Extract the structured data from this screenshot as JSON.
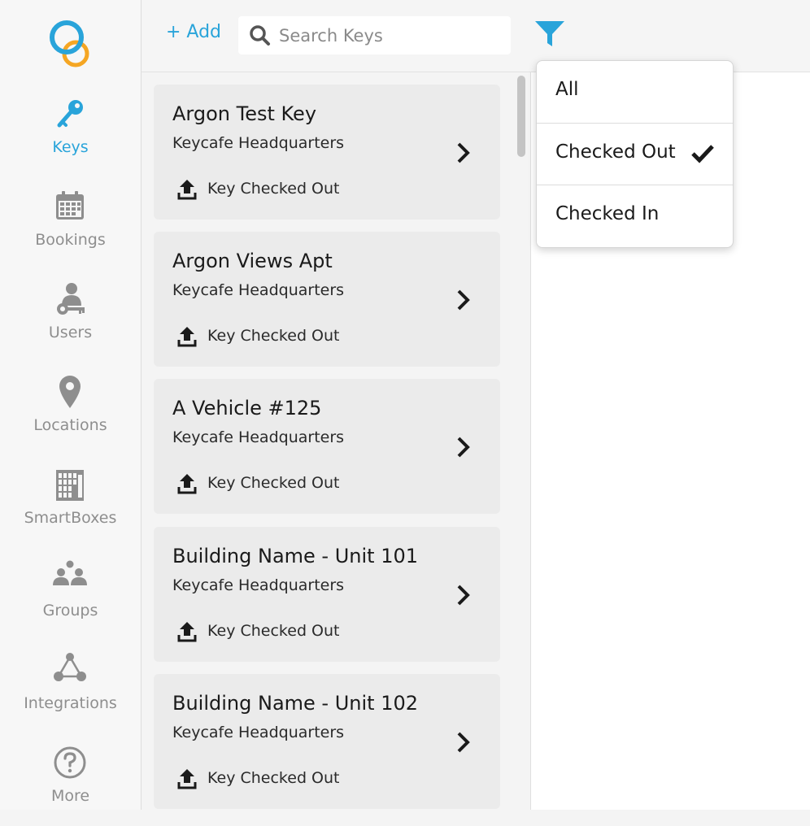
{
  "colors": {
    "accent": "#29a4da",
    "logo_orange": "#f5a623",
    "muted": "#8e8e8e",
    "card_bg": "#ebebeb"
  },
  "sidebar": {
    "logo": "keycafe-logo",
    "items": [
      {
        "label": "Keys",
        "icon": "key-icon",
        "active": true
      },
      {
        "label": "Bookings",
        "icon": "calendar-icon",
        "active": false
      },
      {
        "label": "Users",
        "icon": "user-key-icon",
        "active": false
      },
      {
        "label": "Locations",
        "icon": "location-pin-icon",
        "active": false
      },
      {
        "label": "SmartBoxes",
        "icon": "smartbox-icon",
        "active": false
      },
      {
        "label": "Groups",
        "icon": "groups-icon",
        "active": false
      },
      {
        "label": "Integrations",
        "icon": "integrations-icon",
        "active": false
      },
      {
        "label": "More",
        "icon": "help-icon",
        "active": false
      }
    ]
  },
  "toolbar": {
    "add_label": "+ Add",
    "search_placeholder": "Search Keys",
    "search_value": "",
    "filter_icon": "filter-icon"
  },
  "keys": [
    {
      "name": "Argon Test Key",
      "location": "Keycafe Headquarters",
      "status": "Key Checked Out"
    },
    {
      "name": "Argon Views Apt",
      "location": "Keycafe Headquarters",
      "status": "Key Checked Out"
    },
    {
      "name": "A Vehicle #125",
      "location": "Keycafe Headquarters",
      "status": "Key Checked Out"
    },
    {
      "name": "Building Name - Unit 101",
      "location": "Keycafe Headquarters",
      "status": "Key Checked Out"
    },
    {
      "name": "Building Name - Unit 102",
      "location": "Keycafe Headquarters",
      "status": "Key Checked Out"
    }
  ],
  "filter_menu": {
    "options": [
      {
        "label": "All",
        "selected": false
      },
      {
        "label": "Checked Out",
        "selected": true
      },
      {
        "label": "Checked In",
        "selected": false
      }
    ]
  }
}
